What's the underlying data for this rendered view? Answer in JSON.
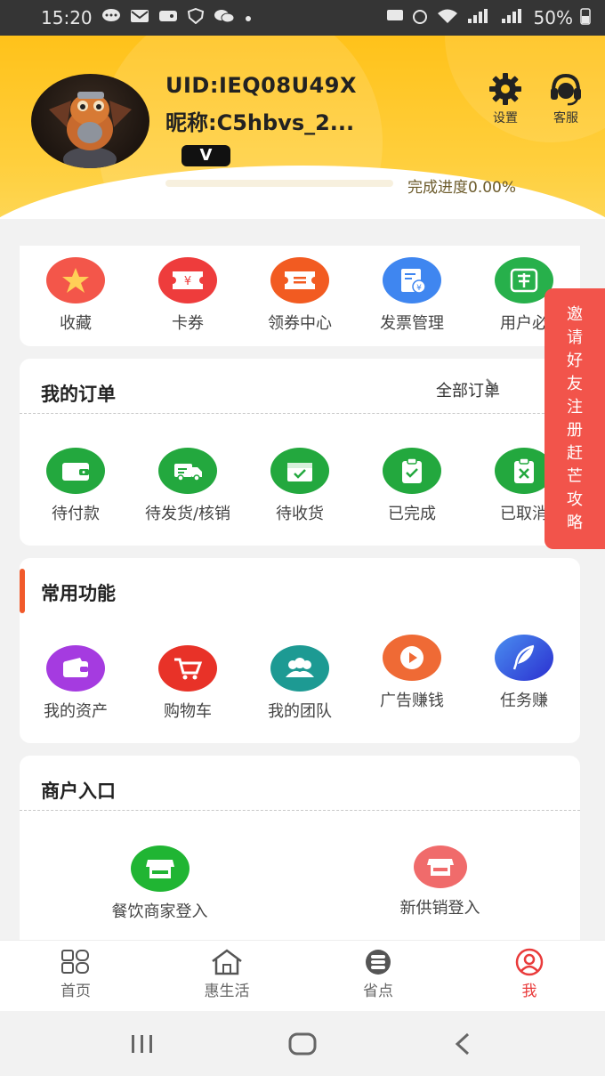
{
  "status_bar": {
    "time": "15:20",
    "battery": "50%"
  },
  "header": {
    "uid": "UID:IEQ08U49X",
    "nickname": "昵称:C5hbvs_2...",
    "vip_badge": "V",
    "progress_text": "完成进度0.00%",
    "progress_fraction": 0.0,
    "settings_label": "设置",
    "service_label": "客服"
  },
  "quick": [
    {
      "label": "收藏",
      "icon": "star-icon",
      "color": "#f3564a"
    },
    {
      "label": "卡券",
      "icon": "ticket-icon",
      "color": "#ee3c3c"
    },
    {
      "label": "领券中心",
      "icon": "coupon-icon",
      "color": "#f25b21"
    },
    {
      "label": "发票管理",
      "icon": "invoice-icon",
      "color": "#3f86f0"
    },
    {
      "label": "用户必",
      "icon": "agreement-icon",
      "color": "#27b04b"
    }
  ],
  "orders": {
    "title": "我的订单",
    "all_label": "全部订单",
    "items": [
      {
        "label": "待付款",
        "icon": "wallet-icon"
      },
      {
        "label": "待发货/核销",
        "icon": "truck-icon"
      },
      {
        "label": "待收货",
        "icon": "receive-box-icon"
      },
      {
        "label": "已完成",
        "icon": "clipboard-check-icon"
      },
      {
        "label": "已取消",
        "icon": "clipboard-x-icon"
      }
    ]
  },
  "functions": {
    "title": "常用功能",
    "items": [
      {
        "label": "我的资产",
        "icon": "wallet-icon",
        "color": "#a53be0"
      },
      {
        "label": "购物车",
        "icon": "cart-icon",
        "color": "#e83228"
      },
      {
        "label": "我的团队",
        "icon": "team-icon",
        "color": "#1d9a93"
      },
      {
        "label": "广告赚钱",
        "icon": "play-icon",
        "color": "#ef6a35"
      },
      {
        "label": "任务赚",
        "icon": "feather-icon",
        "color": "#2b4fd8"
      }
    ]
  },
  "merchant": {
    "title": "商户入口",
    "items": [
      {
        "label": "餐饮商家登入",
        "icon": "store-icon",
        "color": "#20b533"
      },
      {
        "label": "新供销登入",
        "icon": "store-icon",
        "color": "#f06b6b"
      }
    ]
  },
  "invite_banner": "邀请好友注册赶芒攻略",
  "tabs": [
    {
      "label": "首页",
      "icon": "grid-icon"
    },
    {
      "label": "惠生活",
      "icon": "home-icon"
    },
    {
      "label": "省点",
      "icon": "coins-icon"
    },
    {
      "label": "我",
      "icon": "profile-icon",
      "active": true
    }
  ]
}
